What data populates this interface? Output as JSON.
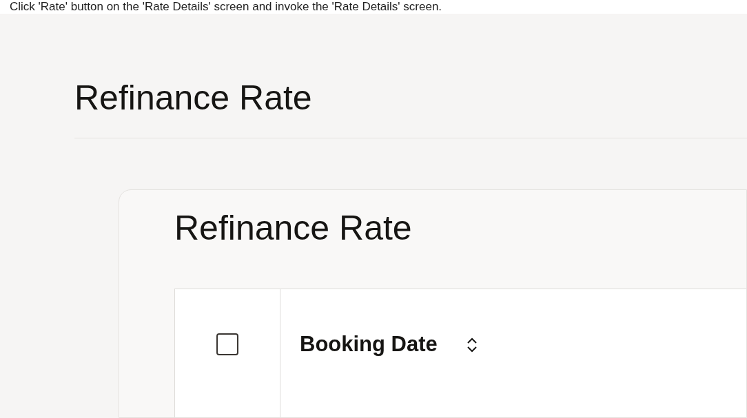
{
  "instruction": "Click 'Rate' button on the 'Rate Details' screen and invoke the 'Rate Details' screen.",
  "page": {
    "title": "Refinance Rate"
  },
  "card": {
    "title": "Refinance Rate"
  },
  "table": {
    "select_all": {
      "checked": false
    },
    "columns": [
      {
        "label": "Booking Date",
        "sortable": true
      }
    ]
  }
}
